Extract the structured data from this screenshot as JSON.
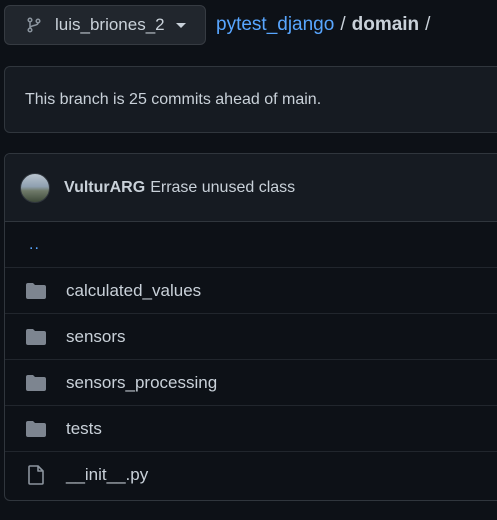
{
  "branch": {
    "name": "luis_briones_2",
    "icon": "git-branch-icon"
  },
  "breadcrumb": {
    "repo": "pytest_django",
    "separator": "/",
    "current": "domain",
    "trailing": "/"
  },
  "notice": {
    "text": "This branch is 25 commits ahead of main."
  },
  "commit": {
    "author": "VulturARG",
    "message": "Errase unused class"
  },
  "updir": {
    "label": ".."
  },
  "files": [
    {
      "name": "calculated_values",
      "type": "dir",
      "icon": "folder-icon"
    },
    {
      "name": "sensors",
      "type": "dir",
      "icon": "folder-icon"
    },
    {
      "name": "sensors_processing",
      "type": "dir",
      "icon": "folder-icon"
    },
    {
      "name": "tests",
      "type": "dir",
      "icon": "folder-icon"
    },
    {
      "name": "__init__.py",
      "type": "file",
      "icon": "file-icon"
    }
  ],
  "colors": {
    "background": "#0d1117",
    "link": "#58a6ff",
    "text": "#c9d1d9",
    "folder": "#7d8590"
  }
}
